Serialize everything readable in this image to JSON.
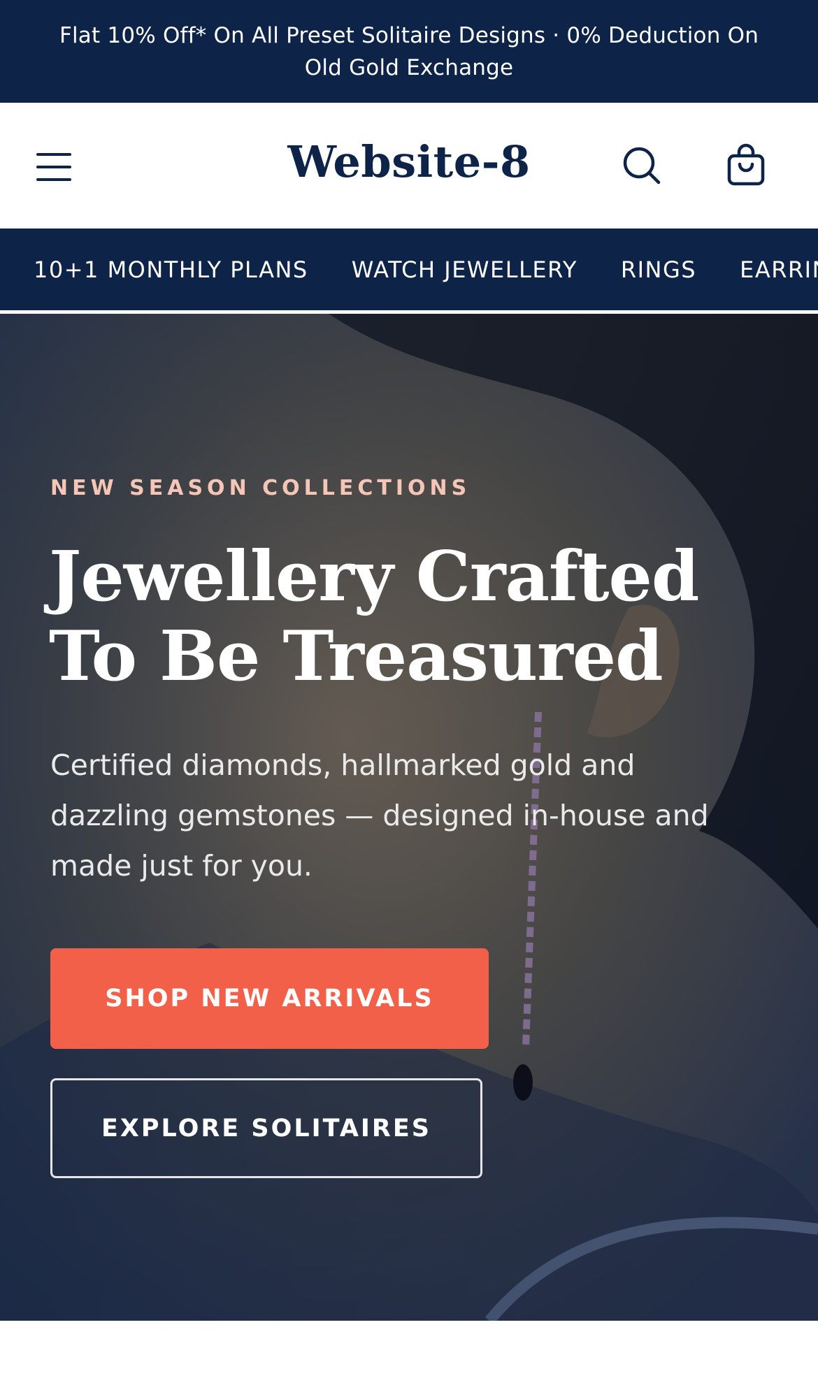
{
  "announcement": {
    "text": "Flat 10% Off* On All Preset Solitaire Designs · 0% Deduction On Old Gold Exchange"
  },
  "header": {
    "brand": "Website-8",
    "icons": {
      "menu": "menu-icon",
      "search": "search-icon",
      "cart": "cart-icon"
    }
  },
  "nav": {
    "items": [
      {
        "label": "10+1 MONTHLY PLANS"
      },
      {
        "label": "WATCH JEWELLERY"
      },
      {
        "label": "RINGS"
      },
      {
        "label": "EARRINGS"
      }
    ]
  },
  "hero": {
    "eyebrow": "NEW SEASON COLLECTIONS",
    "title": "Jewellery Crafted To Be Treasured",
    "subtitle": "Certified diamonds, hallmarked gold and dazzling gemstones — designed in-house and made just for you.",
    "primary_cta": "SHOP NEW ARRIVALS",
    "secondary_cta": "EXPLORE SOLITAIRES"
  },
  "colors": {
    "navy": "#0d2347",
    "accent": "#f2604a",
    "eyebrow": "#f5c6b6",
    "white": "#ffffff"
  }
}
